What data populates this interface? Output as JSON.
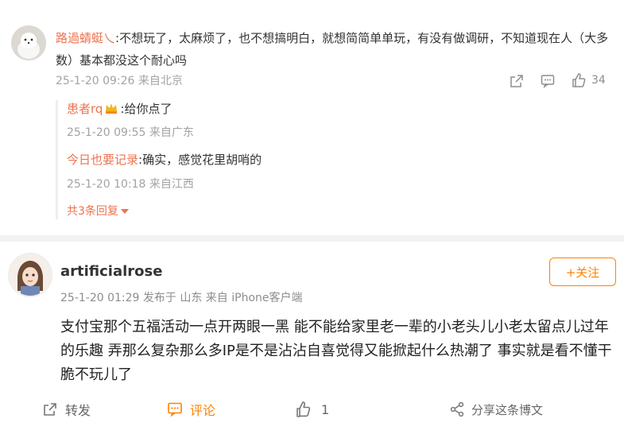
{
  "comment": {
    "username": "路過蜻蜓乀",
    "text": ":不想玩了，太麻烦了，也不想搞明白，就想简简单单玩，有没有做调研，不知道现在人（大多数）基本都没这个耐心吗",
    "meta": "25-1-20 09:26 来自北京",
    "like_count": "34",
    "replies": [
      {
        "username": "患者rq",
        "text": ":给你点了",
        "meta": "25-1-20 09:55 来自广东"
      },
      {
        "username": "今日也要记录",
        "text": ":确实，感觉花里胡哨的",
        "meta": "25-1-20 10:18 来自江西"
      }
    ],
    "more_replies": "共3条回复"
  },
  "post": {
    "username": "artificialrose",
    "meta": "25-1-20 01:29 发布于 山东 来自 iPhone客户端",
    "follow_label": "+关注",
    "body": "支付宝那个五福活动一点开两眼一黑 能不能给家里老一辈的小老头儿小老太留点儿过年的乐趣 弄那么复杂那么多IP是不是沾沾自喜觉得又能掀起什么热潮了 事实就是看不懂干脆不玩儿了",
    "actions": {
      "repost": "转发",
      "comment": "评论",
      "like": "1",
      "share": "分享这条博文"
    }
  },
  "colors": {
    "username": "#eb7350",
    "follow": "#ff8200",
    "comment_active": "#ff8200"
  }
}
